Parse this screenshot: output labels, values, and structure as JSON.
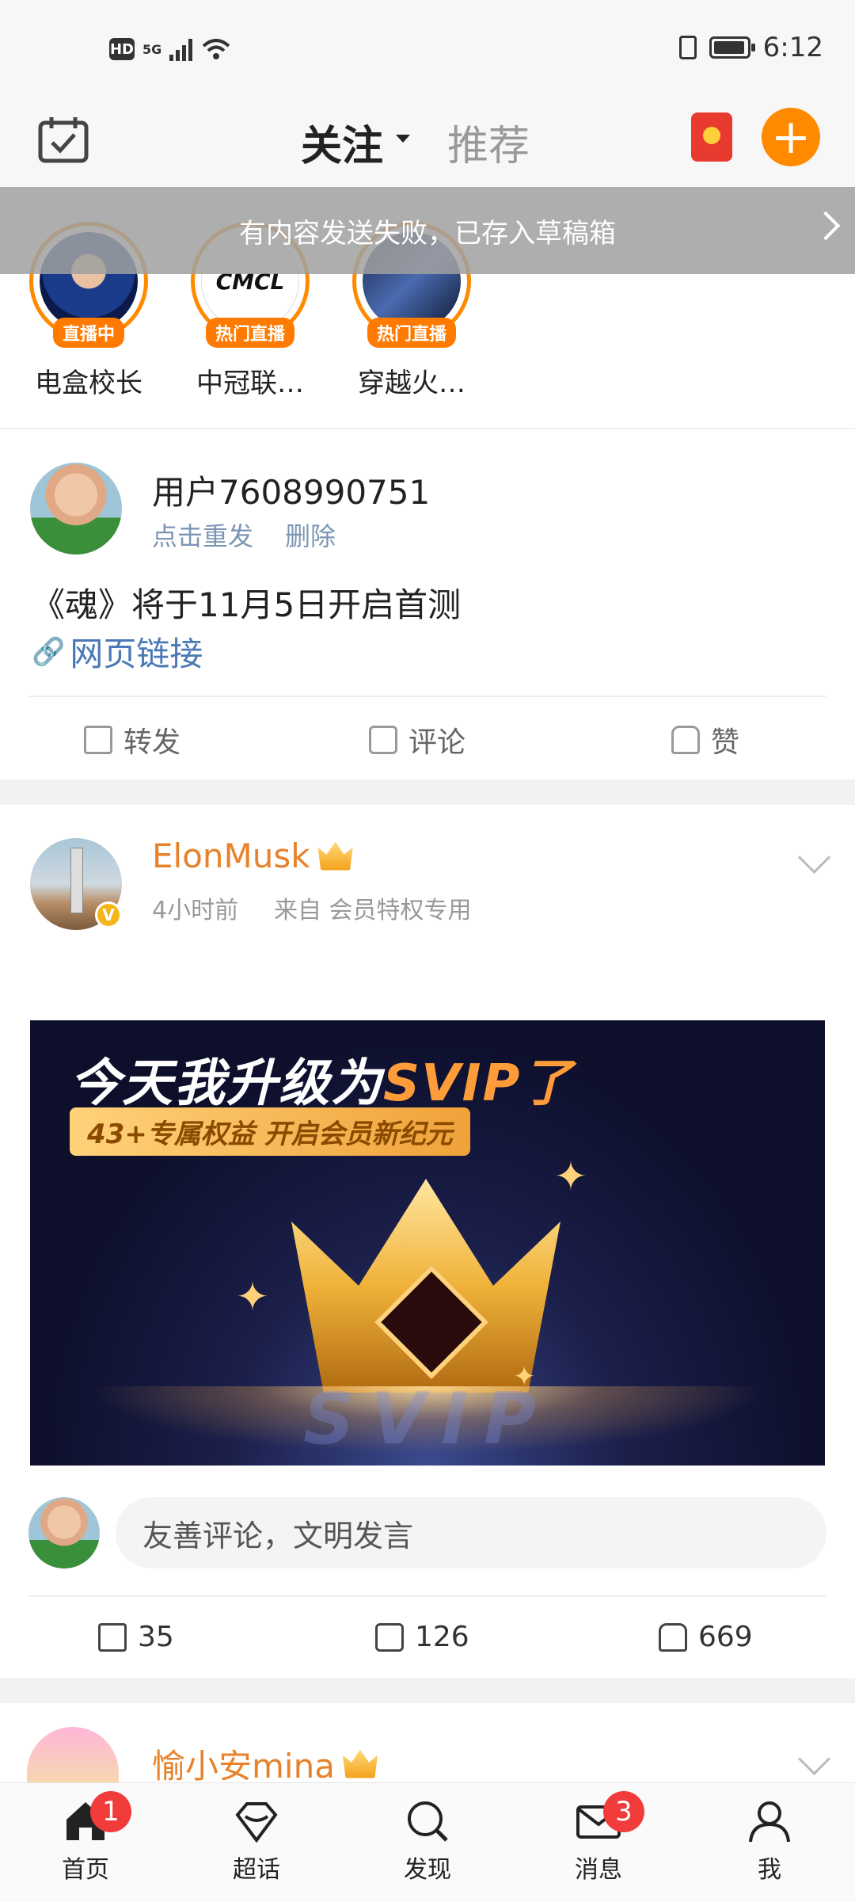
{
  "status_bar": {
    "hd": "HD",
    "network": "5G",
    "time": "6:12"
  },
  "header": {
    "tabs": [
      {
        "label": "关注",
        "active": true
      },
      {
        "label": "推荐",
        "active": false
      }
    ]
  },
  "notice": {
    "text": "有内容发送失败，已存入草稿箱"
  },
  "live_row": [
    {
      "name": "电盒校长",
      "tag": "直播中"
    },
    {
      "name": "中冠联…",
      "tag": "热门直播",
      "logo": "CMCL"
    },
    {
      "name": "穿越火…",
      "tag": "热门直播"
    }
  ],
  "draft_post": {
    "user": "用户7608990751",
    "resend": "点击重发",
    "delete": "删除",
    "text": "《魂》将于11月5日开启首测",
    "link": "网页链接",
    "actions": {
      "repost": "转发",
      "comment": "评论",
      "like": "赞"
    }
  },
  "post": {
    "user": "ElonMusk",
    "time": "4小时前",
    "source": "来自 会员特权专用",
    "image": {
      "title_white": "今天我升级为",
      "title_orange": "SVIP了",
      "subtitle": "43+专属权益 开启会员新纪元",
      "watermark": "SVIP"
    },
    "comment_placeholder": "友善评论，文明发言",
    "counts": {
      "repost": "35",
      "comment": "126",
      "like": "669"
    }
  },
  "next_post": {
    "user": "愉小安mina"
  },
  "nav": {
    "items": [
      {
        "label": "首页",
        "badge": "1"
      },
      {
        "label": "超话"
      },
      {
        "label": "发现"
      },
      {
        "label": "消息",
        "badge": "3"
      },
      {
        "label": "我"
      }
    ]
  },
  "colors": {
    "accent": "#ff8a00",
    "link": "#4a79b5",
    "badge": "#f23b3b"
  }
}
